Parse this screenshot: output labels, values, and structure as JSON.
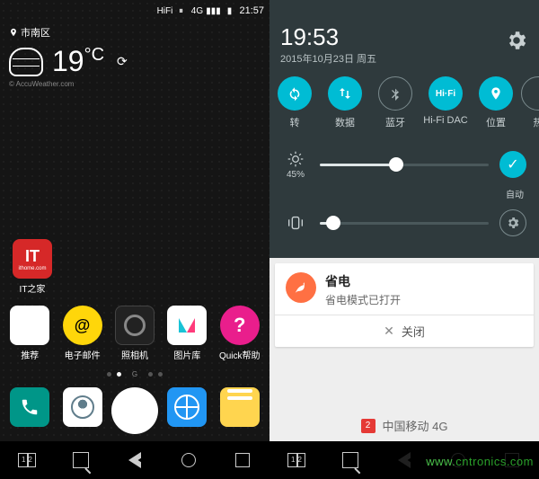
{
  "left": {
    "status": {
      "icons": [
        "hifi",
        "vibrate",
        "signal-4g",
        "signal",
        "battery"
      ],
      "time": "21:57"
    },
    "location": "市南区",
    "weather": {
      "temp": "19",
      "unit": "°C",
      "attribution": "© AccuWeather.com"
    },
    "standalone_app": {
      "label": "IT之家",
      "badge": "IT",
      "sub": "ithome.com"
    },
    "row_apps": [
      {
        "label": "推荐"
      },
      {
        "label": "电子邮件"
      },
      {
        "label": "照相机"
      },
      {
        "label": "图片库"
      },
      {
        "label": "Quick帮助"
      }
    ],
    "page_indicator": {
      "count": 4,
      "active": 1,
      "brand": "G"
    },
    "dock": [
      {
        "name": "phone"
      },
      {
        "name": "contacts"
      },
      {
        "name": "apps"
      },
      {
        "name": "browser"
      },
      {
        "name": "messages"
      }
    ]
  },
  "right": {
    "clock": {
      "time": "19:53",
      "date": "2015年10月23日 周五"
    },
    "toggles": [
      {
        "label": "转",
        "state": "on",
        "icon": "rotate"
      },
      {
        "label": "数据",
        "state": "on",
        "icon": "data"
      },
      {
        "label": "蓝牙",
        "state": "off",
        "icon": "bt"
      },
      {
        "label": "Hi-Fi DAC",
        "state": "on",
        "icon": "hifi",
        "text": "Hi·Fi"
      },
      {
        "label": "位置",
        "state": "on",
        "icon": "location"
      },
      {
        "label": "热",
        "state": "off",
        "icon": "hotspot"
      }
    ],
    "brightness": {
      "value": 45,
      "label": "45%",
      "auto_label": "自动",
      "auto_on": true
    },
    "volume": {
      "value": 8
    },
    "notification": {
      "title": "省电",
      "subtitle": "省电模式已打开",
      "action": "关闭"
    },
    "carrier": {
      "sim": "2",
      "name": "中国移动 4G"
    }
  },
  "watermark": "www.cntronics.com"
}
